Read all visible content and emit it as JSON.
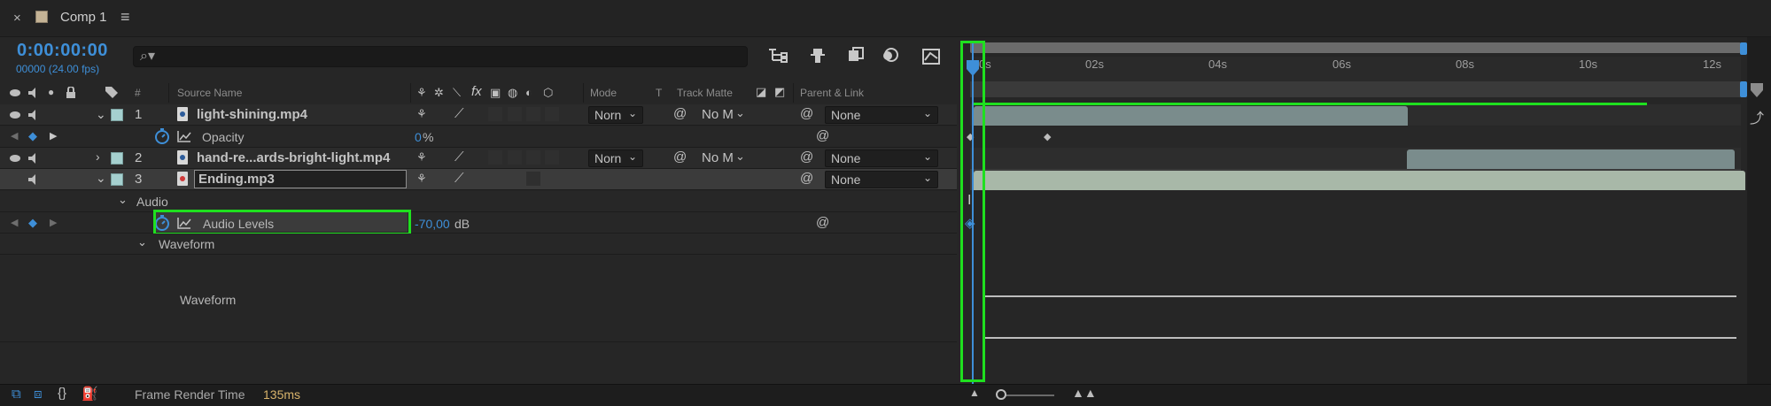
{
  "tab": {
    "close": "×",
    "title": "Comp 1",
    "menu": "≡"
  },
  "comp": {
    "timecode": "0:00:00:00",
    "fps": "00000 (24.00 fps)",
    "search_icon": "⌕▾"
  },
  "columns": {
    "hash": "#",
    "source_name": "Source Name",
    "mode": "Mode",
    "t": "T",
    "track_matte": "Track Matte",
    "parent_link": "Parent & Link"
  },
  "layers": [
    {
      "num": "1",
      "name": "light-shining.mp4",
      "mode": "Norn",
      "matte": "No M",
      "parent": "None"
    },
    {
      "num": "2",
      "name": "hand-re...ards-bright-light.mp4",
      "mode": "Norn",
      "matte": "No M",
      "parent": "None"
    },
    {
      "num": "3",
      "name": "Ending.mp3",
      "parent": "None"
    }
  ],
  "properties": {
    "opacity_label": "Opacity",
    "opacity_value": "0",
    "opacity_unit": "%",
    "audio_group": "Audio",
    "audio_levels_label": "Audio Levels",
    "audio_levels_value": "-70,00",
    "audio_levels_unit": "dB",
    "waveform_group": "Waveform",
    "waveform_label": "Waveform"
  },
  "ruler": {
    "labels": [
      "0s",
      "02s",
      "04s",
      "06s",
      "08s",
      "10s",
      "12s"
    ]
  },
  "footer": {
    "frt_label": "Frame Render Time",
    "frt_value": "135ms"
  },
  "colors": {
    "accent": "#3e8fd8",
    "highlight": "#1fe01f",
    "label": "#a5d0cf"
  }
}
